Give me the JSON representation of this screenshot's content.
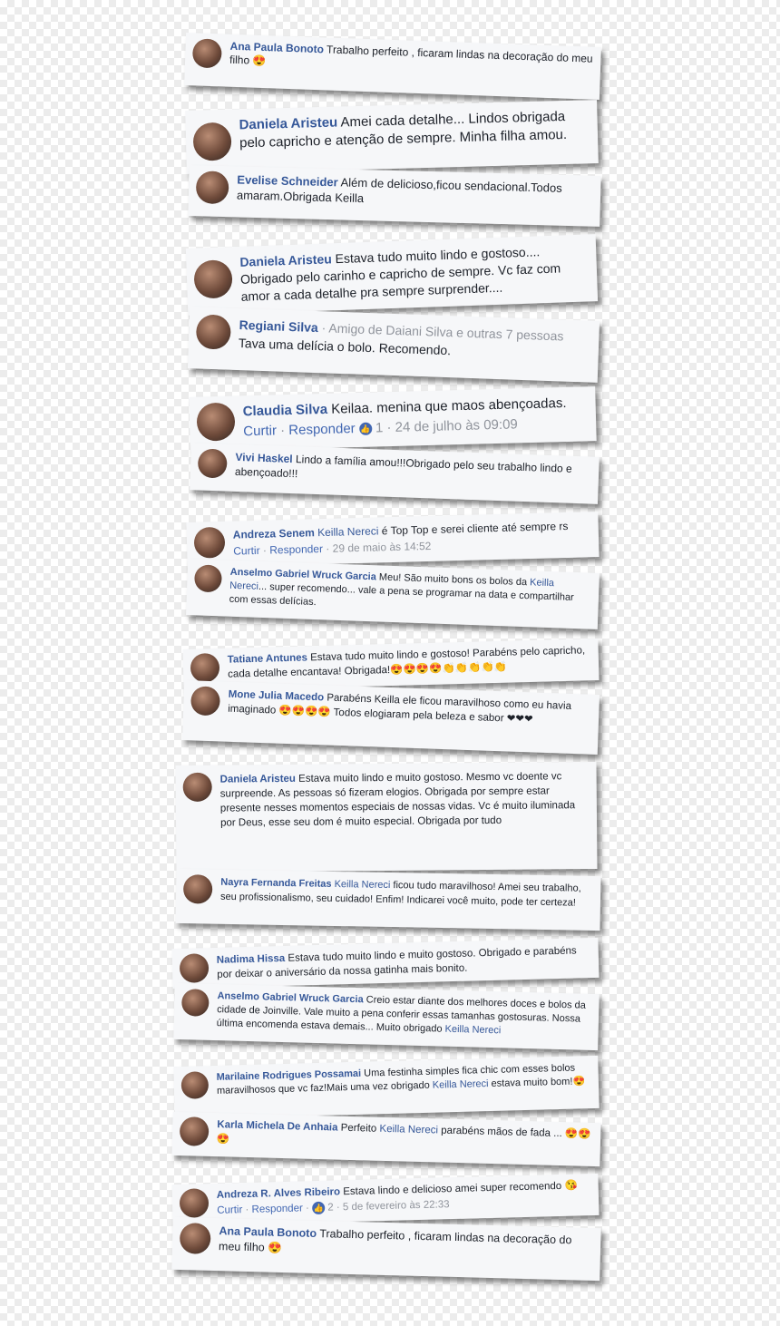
{
  "comments": [
    {
      "name": "Ana Paula Bonoto",
      "text": "Trabalho perfeito , ficaram lindas na decoração do meu filho 😍"
    },
    {
      "name": "Daniela Aristeu",
      "text": "Amei cada detalhe... Lindos obrigada pelo capricho e atenção de sempre. Minha filha amou."
    },
    {
      "name": "Evelise Schneider",
      "text": "Além de delicioso,ficou sendacional.Todos amaram.Obrigada Keilla"
    },
    {
      "name": "Daniela Aristeu",
      "text": "Estava tudo muito lindo e gostoso.... Obrigado pelo carinho e capricho de sempre. Vc faz com amor a cada detalhe pra sempre surprender...."
    },
    {
      "name": "Regiani Silva",
      "meta": "· Amigo de Daiani Silva e outras 7 pessoas",
      "text": "Tava uma delícia o bolo. Recomendo."
    },
    {
      "name": "Claudia Silva",
      "text": "Keilaa. menina que maos abençoadas.",
      "actions": {
        "like": "Curtir",
        "reply": "Responder",
        "likes": "1",
        "date": "24 de julho às 09:09"
      }
    },
    {
      "name": "Vivi Haskel",
      "text": "Lindo a família amou!!!Obrigado pelo seu trabalho lindo e abençoado!!!"
    },
    {
      "name": "Andreza Senem",
      "mention": "Keilla Nereci",
      "text": "é Top Top e serei cliente até sempre rs",
      "actions": {
        "like": "Curtir",
        "reply": "Responder",
        "date": "29 de maio às 14:52"
      }
    },
    {
      "name": "Anselmo Gabriel Wruck Garcia",
      "text": "Meu! São muito bons os bolos da",
      "mention": "Keilla Nereci",
      "text2": "... super recomendo... vale a pena se programar na data e compartilhar com essas delícias."
    },
    {
      "name": "Tatiane Antunes",
      "text": "Estava tudo muito lindo e gostoso! Parabéns pelo capricho, cada detalhe encantava! Obrigada!😍😍😍😍👏👏👏👏👏"
    },
    {
      "name": "Mone Julia Macedo",
      "text": "Parabéns Keilla ele ficou maravilhoso como eu havia imaginado 😍😍😍😍 Todos elogiaram pela beleza e sabor ❤❤❤"
    },
    {
      "name": "Daniela Aristeu",
      "text": "Estava muito lindo e muito gostoso. Mesmo vc doente vc surpreende. As pessoas só fizeram elogios. Obrigada por sempre estar presente nesses momentos especiais de nossas vidas. Vc é muito iluminada por Deus, esse seu dom é muito especial. Obrigada por tudo"
    },
    {
      "name": "Nayra Fernanda Freitas",
      "mention": "Keilla Nereci",
      "text": "ficou tudo maravilhoso! Amei seu trabalho, seu profissionalismo, seu cuidado! Enfim! Indicarei você muito, pode ter certeza!"
    },
    {
      "name": "Nadima Hissa",
      "text": "Estava tudo muito lindo e muito gostoso. Obrigado e parabéns por deixar o aniversário da nossa gatinha mais bonito."
    },
    {
      "name": "Anselmo Gabriel Wruck Garcia",
      "text": "Creio estar diante dos melhores doces e bolos da cidade de Joinville. Vale muito a pena conferir essas tamanhas gostosuras. Nossa última encomenda estava demais... Muito obrigado",
      "mention": "Keilla Nereci"
    },
    {
      "name": "Marilaine Rodrigues Possamai",
      "text": "Uma festinha simples fica chic com esses bolos maravilhosos que vc faz!Mais uma vez obrigado",
      "mention": "Keilla Nereci",
      "text2": "estava muito bom!😍"
    },
    {
      "name": "Karla Michela De Anhaia",
      "text": "Perfeito",
      "mention": "Keilla Nereci",
      "text2": "parabéns mãos de fada ... 😍😍😍"
    },
    {
      "name": "Andreza R. Alves Ribeiro",
      "text": "Estava lindo e delicioso amei super recomendo 😘",
      "actions": {
        "like": "Curtir",
        "reply": "Responder",
        "likes": "2",
        "date": "5 de fevereiro às 22:33"
      }
    },
    {
      "name": "Ana Paula Bonoto",
      "text": "Trabalho perfeito , ficaram lindas na decoração do meu filho 😍"
    }
  ]
}
